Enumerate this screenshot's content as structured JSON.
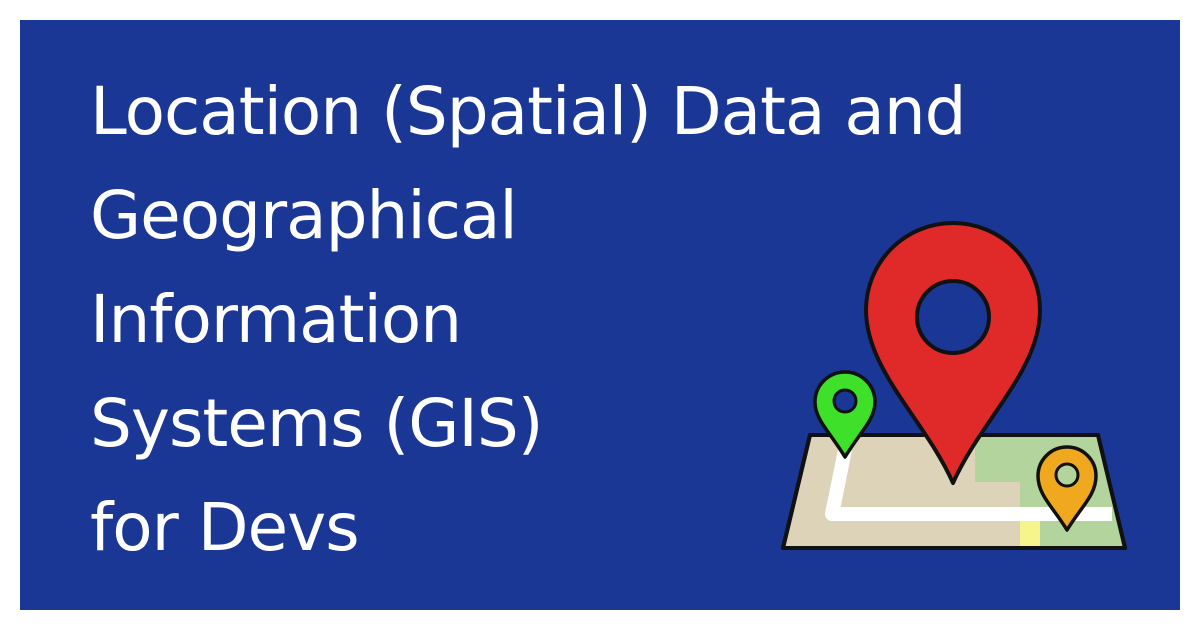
{
  "title_lines": [
    "Location (Spatial) Data and",
    "Geographical",
    "Information",
    "Systems (GIS)",
    "for Devs"
  ],
  "illustration": {
    "icons": [
      "map-icon",
      "red-location-pin-icon",
      "green-location-pin-icon",
      "orange-location-pin-icon"
    ]
  },
  "colors": {
    "background": "#1a3796",
    "text": "#ffffff",
    "map_paper": "#dcd3b9",
    "map_green": "#b3d49c",
    "map_yellow": "#f5f58c",
    "road": "#ffffff",
    "pin_red": "#e02a2a",
    "pin_green": "#3ee02a",
    "pin_orange": "#f0a81e",
    "outline": "#111111"
  }
}
